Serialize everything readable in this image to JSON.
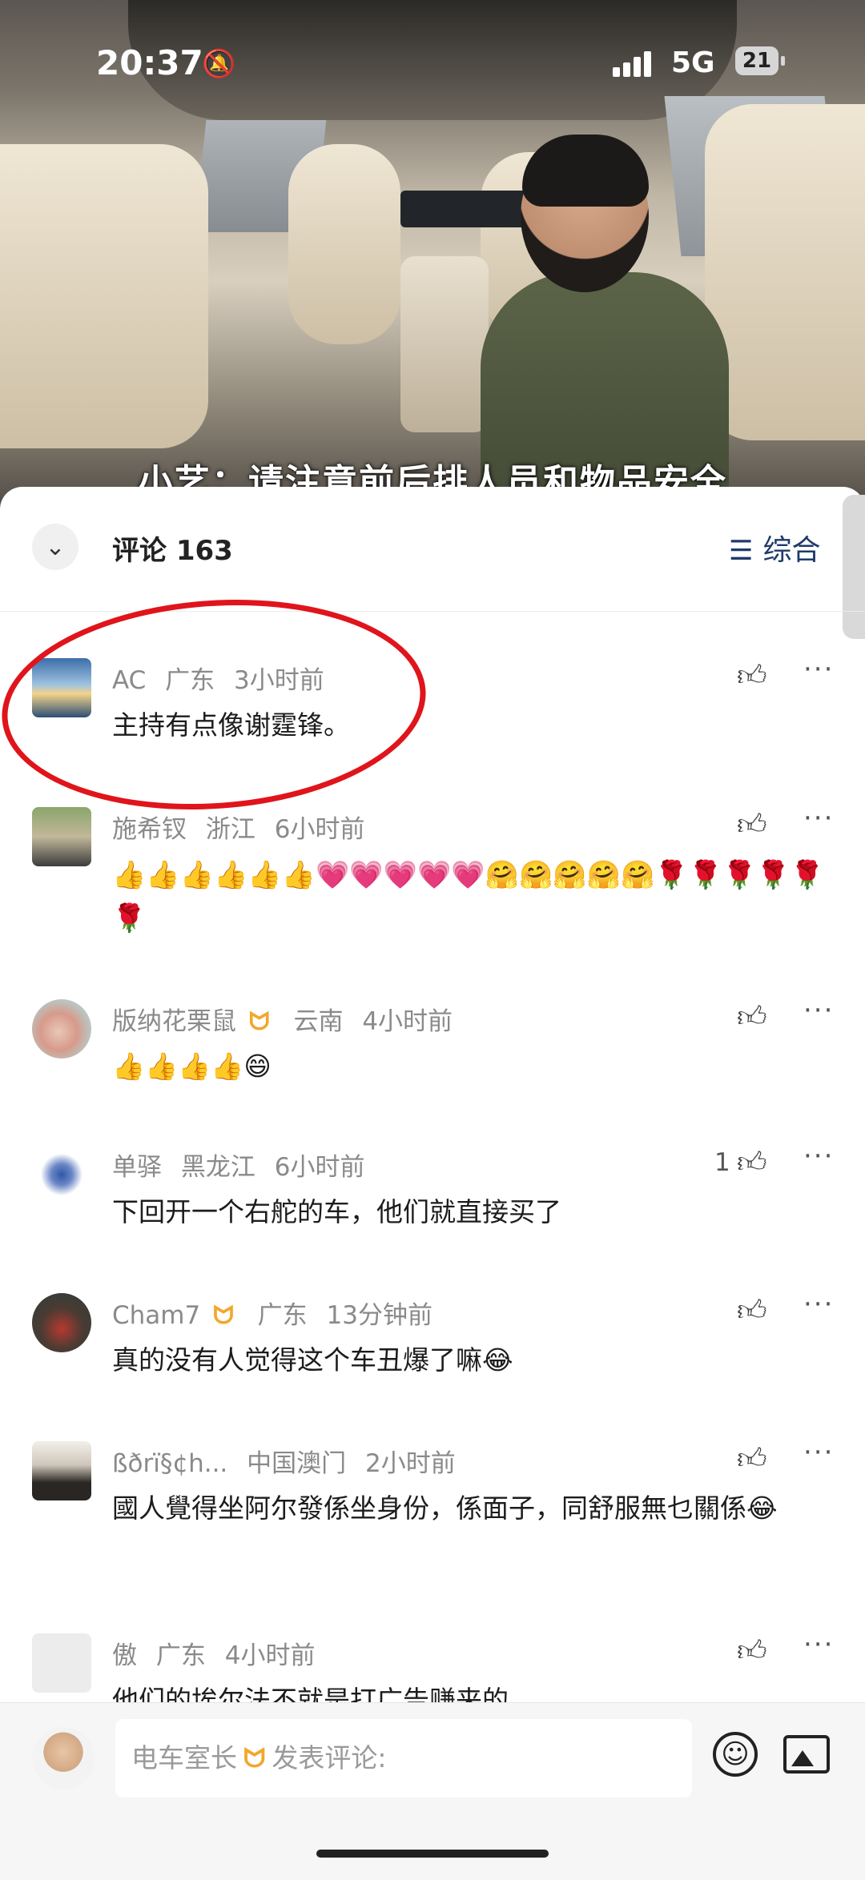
{
  "status_bar": {
    "time": "20:37",
    "silent_icon": "bell-slash-icon",
    "network": "5G",
    "battery": "21"
  },
  "video": {
    "subtitle": "小艺：请注意前后排人员和物品安全"
  },
  "comments_header": {
    "title": "评论 163",
    "sort_label": "综合",
    "sort_icon": "☰",
    "collapse_icon": "⌄"
  },
  "comments": [
    {
      "name": "AC",
      "badge": "",
      "region": "广东",
      "time": "3小时前",
      "text": "主持有点像谢霆锋。",
      "likes": ""
    },
    {
      "name": "施希钗",
      "badge": "",
      "region": "浙江",
      "time": "6小时前",
      "text": "👍👍👍👍👍👍💗💗💗💗💗🤗🤗🤗🤗🤗🌹🌹🌹🌹🌹🌹",
      "likes": ""
    },
    {
      "name": "版纳花栗鼠",
      "badge": "ᗢ",
      "region": "云南",
      "time": "4小时前",
      "text": "👍👍👍👍😄",
      "likes": ""
    },
    {
      "name": "单驿",
      "badge": "",
      "region": "黑龙江",
      "time": "6小时前",
      "text": "下回开一个右舵的车，他们就直接买了",
      "likes": "1"
    },
    {
      "name": "Cham7",
      "badge": "ᗢ",
      "region": "广东",
      "time": "13分钟前",
      "text": "真的没有人觉得这个车丑爆了嘛😂",
      "likes": ""
    },
    {
      "name": "ßðrï§¢h...",
      "badge": "",
      "region": "中国澳门",
      "time": "2小时前",
      "text": "國人覺得坐阿尔發係坐身份，係面子，同舒服無乜關係😂",
      "likes": ""
    },
    {
      "name": "傲",
      "badge": "",
      "region": "广东",
      "time": "4小时前",
      "text": "他们的埃尔法不就是打广告赚来的",
      "likes": ""
    }
  ],
  "footer": {
    "user": "电车室长",
    "badge": "ᗢ",
    "placeholder": "发表评论:",
    "emoji_icon": "☺",
    "image_icon": "image-icon"
  },
  "colors": {
    "badge": "#f2a72b",
    "annotation_circle": "#e0141b"
  }
}
